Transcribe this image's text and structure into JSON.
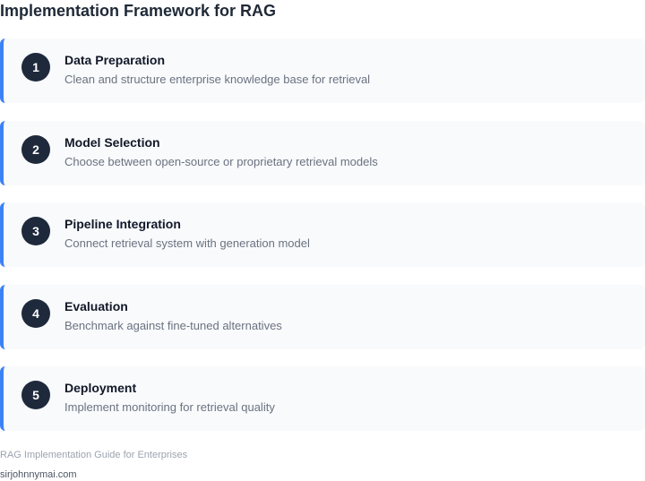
{
  "header": {
    "title": "Implementation Framework for RAG"
  },
  "colors": {
    "accent": "#3b82f6",
    "badge": "#1e293b",
    "card_background": "#f8fafc"
  },
  "steps": [
    {
      "number": "1",
      "title": "Data Preparation",
      "description": "Clean and structure enterprise knowledge base for retrieval"
    },
    {
      "number": "2",
      "title": "Model Selection",
      "description": "Choose between open-source or proprietary retrieval models"
    },
    {
      "number": "3",
      "title": "Pipeline Integration",
      "description": "Connect retrieval system with generation model"
    },
    {
      "number": "4",
      "title": "Evaluation",
      "description": "Benchmark against fine-tuned alternatives"
    },
    {
      "number": "5",
      "title": "Deployment",
      "description": "Implement monitoring for retrieval quality"
    }
  ],
  "footer": {
    "caption": "RAG Implementation Guide for Enterprises",
    "site": "sirjohnnymai.com"
  }
}
